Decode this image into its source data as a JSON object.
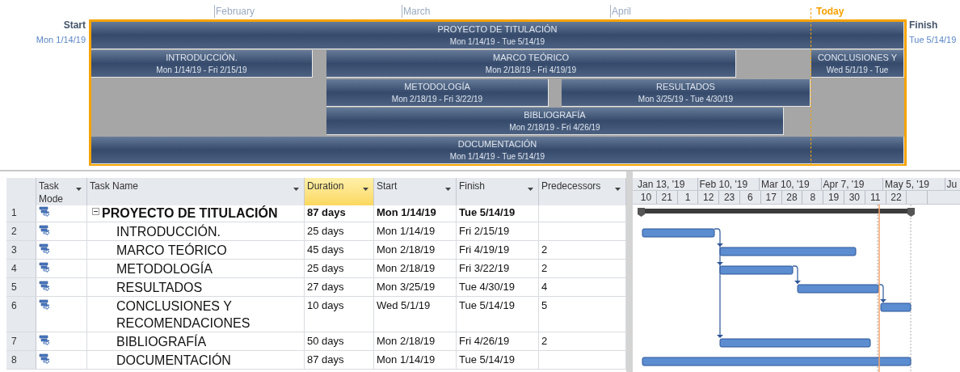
{
  "timeline": {
    "months": [
      "February",
      "March",
      "April"
    ],
    "today_label": "Today",
    "start": {
      "label": "Start",
      "date": "Mon 1/14/19"
    },
    "finish": {
      "label": "Finish",
      "date": "Tue 5/14/19"
    },
    "bars": [
      {
        "name": "PROYECTO DE TITULACIÓN",
        "dates": "Mon 1/14/19 - Tue 5/14/19"
      },
      {
        "name": "INTRODUCCIÓN.",
        "dates": "Mon 1/14/19 - Fri 2/15/19"
      },
      {
        "name": "MARCO TEÓRICO",
        "dates": "Mon 2/18/19 - Fri 4/19/19"
      },
      {
        "name": "CONCLUSIONES Y",
        "dates": "Wed 5/1/19 - Tue"
      },
      {
        "name": "METODOLOGÍA",
        "dates": "Mon 2/18/19 - Fri 3/22/19"
      },
      {
        "name": "RESULTADOS",
        "dates": "Mon 3/25/19 - Tue 4/30/19"
      },
      {
        "name": "BIBLIOGRAFÍA",
        "dates": "Mon 2/18/19 - Fri 4/26/19"
      },
      {
        "name": "DOCUMENTACIÓN",
        "dates": "Mon 1/14/19 - Tue 5/14/19"
      }
    ]
  },
  "table": {
    "columns": [
      {
        "label": "Task Mode",
        "selected": false
      },
      {
        "label": "Task Name",
        "selected": false
      },
      {
        "label": "Duration",
        "selected": true
      },
      {
        "label": "Start",
        "selected": false
      },
      {
        "label": "Finish",
        "selected": false
      },
      {
        "label": "Predecessors",
        "selected": false
      }
    ],
    "rows": [
      {
        "id": "1",
        "name": "PROYECTO DE TITULACIÓN",
        "summary": true,
        "expanded": true,
        "duration": "87 days",
        "start": "Mon 1/14/19",
        "finish": "Tue 5/14/19",
        "children": [
          {
            "id": "2",
            "name": "INTRODUCCIÓN.",
            "summary": false,
            "duration": "25 days",
            "start": "Mon 1/14/19",
            "finish": "Fri 2/15/19"
          },
          {
            "id": "3",
            "name": "MARCO TEÓRICO",
            "summary": false,
            "duration": "45 days",
            "start": "Mon 2/18/19",
            "finish": "Fri 4/19/19",
            "predecessors": "2"
          },
          {
            "id": "4",
            "name": "METODOLOGÍA",
            "summary": false,
            "duration": "25 days",
            "start": "Mon 2/18/19",
            "finish": "Fri 3/22/19",
            "predecessors": "2"
          },
          {
            "id": "5",
            "name": "RESULTADOS",
            "summary": false,
            "duration": "27 days",
            "start": "Mon 3/25/19",
            "finish": "Tue 4/30/19",
            "predecessors": "4"
          },
          {
            "id": "6",
            "name": "CONCLUSIONES Y RECOMENDACIONES",
            "summary": false,
            "duration": "10 days",
            "start": "Wed 5/1/19",
            "finish": "Tue 5/14/19",
            "predecessors": "5"
          },
          {
            "id": "7",
            "name": "BIBLIOGRAFÍA",
            "summary": false,
            "duration": "50 days",
            "start": "Mon 2/18/19",
            "finish": "Fri 4/26/19",
            "predecessors": "2"
          },
          {
            "id": "8",
            "name": "DOCUMENTACIÓN",
            "summary": false,
            "duration": "87 days",
            "start": "Mon 1/14/19",
            "finish": "Tue 5/14/19"
          }
        ]
      }
    ]
  },
  "gantt": {
    "top_tier": [
      "Jan 13, '19",
      "Feb 10, '19",
      "Mar 10, '19",
      "Apr 7, '19",
      "May 5, '19",
      "Ju"
    ],
    "bottom_tier": [
      "10",
      "21",
      "1",
      "12",
      "23",
      "6",
      "17",
      "28",
      "8",
      "19",
      "30",
      "11",
      "22"
    ]
  }
}
